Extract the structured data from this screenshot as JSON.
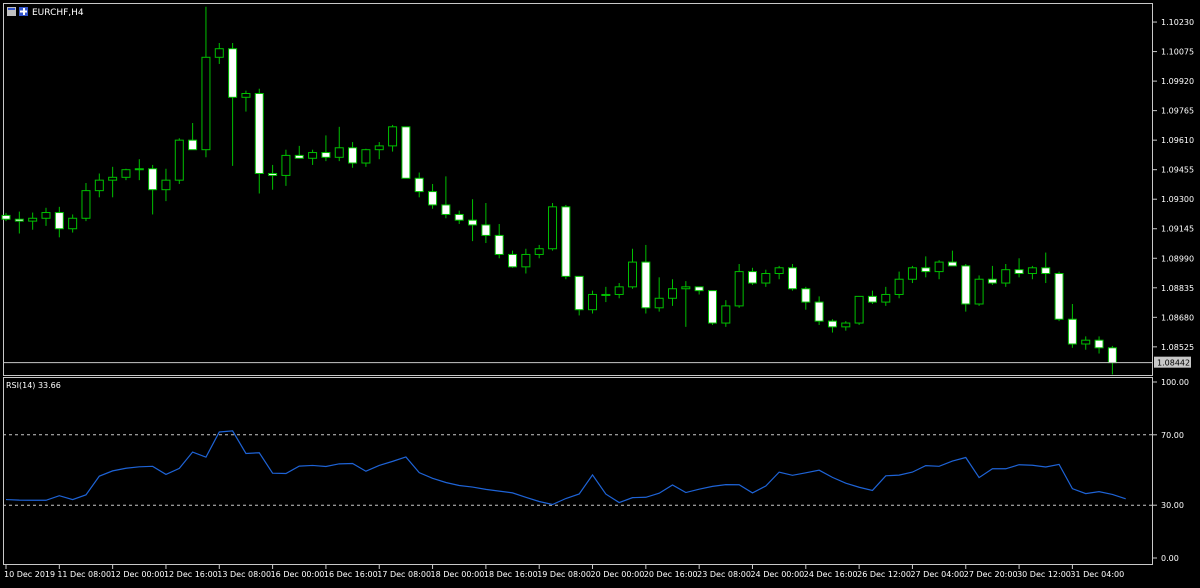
{
  "header": {
    "symbol_timeframe": "EURCHF,H4",
    "indicator_label": "RSI(14) 33.66"
  },
  "colors": {
    "background": "#000000",
    "frame": "#c8c8c8",
    "candle_wick": "#00c000",
    "candle_bull_fill": "#000000",
    "candle_bear_fill": "#ffffff",
    "rsi_line": "#1e63d6",
    "level_line": "#c8c8c8",
    "text": "#ffffff",
    "bid_line": "#c8c8c8",
    "bid_tag_bg": "#c8c8c8",
    "bid_tag_text": "#000000"
  },
  "chart_data": [
    {
      "type": "candlestick",
      "symbol": "EURCHF",
      "timeframe": "H4",
      "bid": "1.08442",
      "y_tick_labels": [
        "1.10230",
        "1.10075",
        "1.09920",
        "1.09765",
        "1.09610",
        "1.09455",
        "1.09300",
        "1.09145",
        "1.08990",
        "1.08835",
        "1.08680",
        "1.08525"
      ],
      "y_ticks": [
        1.1023,
        1.10075,
        1.0992,
        1.09765,
        1.0961,
        1.09455,
        1.093,
        1.09145,
        1.0899,
        1.08835,
        1.0868,
        1.08525
      ],
      "ylim": [
        1.08372,
        1.1033
      ],
      "x_tick_labels": [
        "10 Dec 2019",
        "11 Dec 08:00",
        "12 Dec 00:00",
        "12 Dec 16:00",
        "13 Dec 08:00",
        "16 Dec 00:00",
        "16 Dec 16:00",
        "17 Dec 08:00",
        "18 Dec 00:00",
        "18 Dec 16:00",
        "19 Dec 08:00",
        "20 Dec 00:00",
        "20 Dec 16:00",
        "23 Dec 08:00",
        "24 Dec 00:00",
        "24 Dec 16:00",
        "26 Dec 12:00",
        "27 Dec 04:00",
        "27 Dec 20:00",
        "30 Dec 12:00",
        "31 Dec 04:00"
      ],
      "x_tick_every": 4,
      "ohlc": [
        [
          1.09215,
          1.09228,
          1.09185,
          1.09195
        ],
        [
          1.09195,
          1.09235,
          1.0912,
          1.09185
        ],
        [
          1.09185,
          1.0923,
          1.0914,
          1.092
        ],
        [
          1.092,
          1.09255,
          1.0916,
          1.0923
        ],
        [
          1.0923,
          1.0926,
          1.091,
          1.09145
        ],
        [
          1.09145,
          1.0922,
          1.09125,
          1.092
        ],
        [
          1.092,
          1.09385,
          1.09185,
          1.09345
        ],
        [
          1.09345,
          1.09435,
          1.0931,
          1.094
        ],
        [
          1.094,
          1.0947,
          1.0931,
          1.09415
        ],
        [
          1.09415,
          1.0946,
          1.094,
          1.09455
        ],
        [
          1.09455,
          1.0951,
          1.094,
          1.0946
        ],
        [
          1.0946,
          1.0948,
          1.0922,
          1.0935
        ],
        [
          1.0935,
          1.0946,
          1.0929,
          1.094
        ],
        [
          1.094,
          1.0962,
          1.0938,
          1.0961
        ],
        [
          1.0961,
          1.097,
          1.0956,
          1.0956
        ],
        [
          1.0956,
          1.1031,
          1.0952,
          1.10045
        ],
        [
          1.10045,
          1.1012,
          1.1001,
          1.1009
        ],
        [
          1.1009,
          1.1012,
          1.09475,
          1.09835
        ],
        [
          1.09835,
          1.0987,
          1.0976,
          1.09855
        ],
        [
          1.09855,
          1.0988,
          1.0933,
          1.09435
        ],
        [
          1.09435,
          1.0948,
          1.0935,
          1.09425
        ],
        [
          1.09425,
          1.0956,
          1.0937,
          1.0953
        ],
        [
          1.0953,
          1.0958,
          1.09515,
          1.09515
        ],
        [
          1.09515,
          1.0956,
          1.0948,
          1.09545
        ],
        [
          1.09545,
          1.09635,
          1.095,
          1.0952
        ],
        [
          1.0952,
          1.0968,
          1.095,
          1.0957
        ],
        [
          1.0957,
          1.096,
          1.09465,
          1.0949
        ],
        [
          1.0949,
          1.09565,
          1.0947,
          1.0956
        ],
        [
          1.0956,
          1.096,
          1.0951,
          1.0958
        ],
        [
          1.0958,
          1.0969,
          1.0955,
          1.0968
        ],
        [
          1.0968,
          1.0968,
          1.0941,
          1.0941
        ],
        [
          1.0941,
          1.0944,
          1.0931,
          1.0934
        ],
        [
          1.0934,
          1.0938,
          1.0925,
          1.0927
        ],
        [
          1.0927,
          1.0942,
          1.092,
          1.0922
        ],
        [
          1.0922,
          1.0924,
          1.0917,
          1.0919
        ],
        [
          1.0919,
          1.093,
          1.0908,
          1.09165
        ],
        [
          1.09165,
          1.0928,
          1.0907,
          1.0911
        ],
        [
          1.0911,
          1.0917,
          1.0899,
          1.0901
        ],
        [
          1.0901,
          1.0903,
          1.0894,
          1.08945
        ],
        [
          1.08945,
          1.0904,
          1.0891,
          1.0901
        ],
        [
          1.0901,
          1.0906,
          1.0899,
          1.0904
        ],
        [
          1.0904,
          1.0928,
          1.0903,
          1.0926
        ],
        [
          1.0926,
          1.0927,
          1.0888,
          1.08895
        ],
        [
          1.08895,
          1.08895,
          1.0869,
          1.0872
        ],
        [
          1.0872,
          1.0882,
          1.087,
          1.088
        ],
        [
          1.088,
          1.0884,
          1.0876,
          1.088
        ],
        [
          1.088,
          1.0886,
          1.0878,
          1.0884
        ],
        [
          1.0884,
          1.0904,
          1.0883,
          1.0897
        ],
        [
          1.0897,
          1.0906,
          1.087,
          1.0873
        ],
        [
          1.0873,
          1.0889,
          1.0871,
          1.0878
        ],
        [
          1.0878,
          1.0888,
          1.0874,
          1.0883
        ],
        [
          1.0883,
          1.0887,
          1.0863,
          1.0884
        ],
        [
          1.0884,
          1.0884,
          1.088,
          1.0882
        ],
        [
          1.0882,
          1.0882,
          1.0864,
          1.0865
        ],
        [
          1.0865,
          1.0877,
          1.0863,
          1.0874
        ],
        [
          1.0874,
          1.0896,
          1.0873,
          1.0892
        ],
        [
          1.0892,
          1.0894,
          1.0885,
          1.0886
        ],
        [
          1.0886,
          1.0893,
          1.0884,
          1.0891
        ],
        [
          1.0891,
          1.0895,
          1.0888,
          1.0894
        ],
        [
          1.0894,
          1.0896,
          1.0882,
          1.0883
        ],
        [
          1.0883,
          1.0884,
          1.0872,
          1.0876
        ],
        [
          1.0876,
          1.0879,
          1.0864,
          1.0866
        ],
        [
          1.0866,
          1.0867,
          1.086,
          1.0863
        ],
        [
          1.0863,
          1.0866,
          1.0861,
          1.0865
        ],
        [
          1.0865,
          1.0879,
          1.0864,
          1.0879
        ],
        [
          1.0879,
          1.0882,
          1.0875,
          1.0876
        ],
        [
          1.0876,
          1.0884,
          1.0874,
          1.088
        ],
        [
          1.088,
          1.0892,
          1.0878,
          1.0888
        ],
        [
          1.0888,
          1.0895,
          1.0886,
          1.0894
        ],
        [
          1.0894,
          1.09,
          1.0889,
          1.0892
        ],
        [
          1.0892,
          1.0898,
          1.0888,
          1.0897
        ],
        [
          1.0897,
          1.0903,
          1.0895,
          1.0895
        ],
        [
          1.0895,
          1.0896,
          1.0871,
          1.0875
        ],
        [
          1.0875,
          1.089,
          1.0874,
          1.0888
        ],
        [
          1.0888,
          1.0895,
          1.0885,
          1.0886
        ],
        [
          1.0886,
          1.0896,
          1.0884,
          1.0893
        ],
        [
          1.0893,
          1.0899,
          1.0889,
          1.0891
        ],
        [
          1.0891,
          1.0895,
          1.0888,
          1.0894
        ],
        [
          1.0894,
          1.0902,
          1.0886,
          1.0891
        ],
        [
          1.0891,
          1.0892,
          1.0866,
          1.0867
        ],
        [
          1.0867,
          1.0875,
          1.0852,
          1.0854
        ],
        [
          1.0854,
          1.0858,
          1.0851,
          1.0856
        ],
        [
          1.0856,
          1.0858,
          1.0849,
          1.0852
        ],
        [
          1.0852,
          1.0853,
          1.0838,
          1.08442
        ]
      ]
    },
    {
      "type": "line",
      "name": "RSI(14)",
      "ylim": [
        0,
        100
      ],
      "y_tick_labels": [
        "100.00",
        "70.00",
        "30.00",
        "0.00"
      ],
      "y_ticks": [
        100,
        70,
        30,
        0
      ],
      "levels": [
        70,
        30
      ],
      "values": [
        33.2,
        32.9,
        32.8,
        32.8,
        35.4,
        33.2,
        35.9,
        46.5,
        49.5,
        51.0,
        51.8,
        52.1,
        47.5,
        50.9,
        60.2,
        57.3,
        71.6,
        72.2,
        59.4,
        59.8,
        48.2,
        48.0,
        52.2,
        52.6,
        52.0,
        53.5,
        53.7,
        49.3,
        52.6,
        54.9,
        57.4,
        48.5,
        45.3,
        42.9,
        41.2,
        40.3,
        39.0,
        38.0,
        37.0,
        34.5,
        32.1,
        30.4,
        33.8,
        36.4,
        47.2,
        36.3,
        31.5,
        34.3,
        34.5,
        36.8,
        41.5,
        37.2,
        39.1,
        40.7,
        41.7,
        41.6,
        37.0,
        40.9,
        48.8,
        47.0,
        48.4,
        49.9,
        45.8,
        42.5,
        40.2,
        38.4,
        46.7,
        47.1,
        48.8,
        52.5,
        52.1,
        55.1,
        57.1,
        45.7,
        50.7,
        50.7,
        53.0,
        52.7,
        51.7,
        53.2,
        39.4,
        36.6,
        37.7,
        36.1,
        33.66
      ]
    }
  ]
}
